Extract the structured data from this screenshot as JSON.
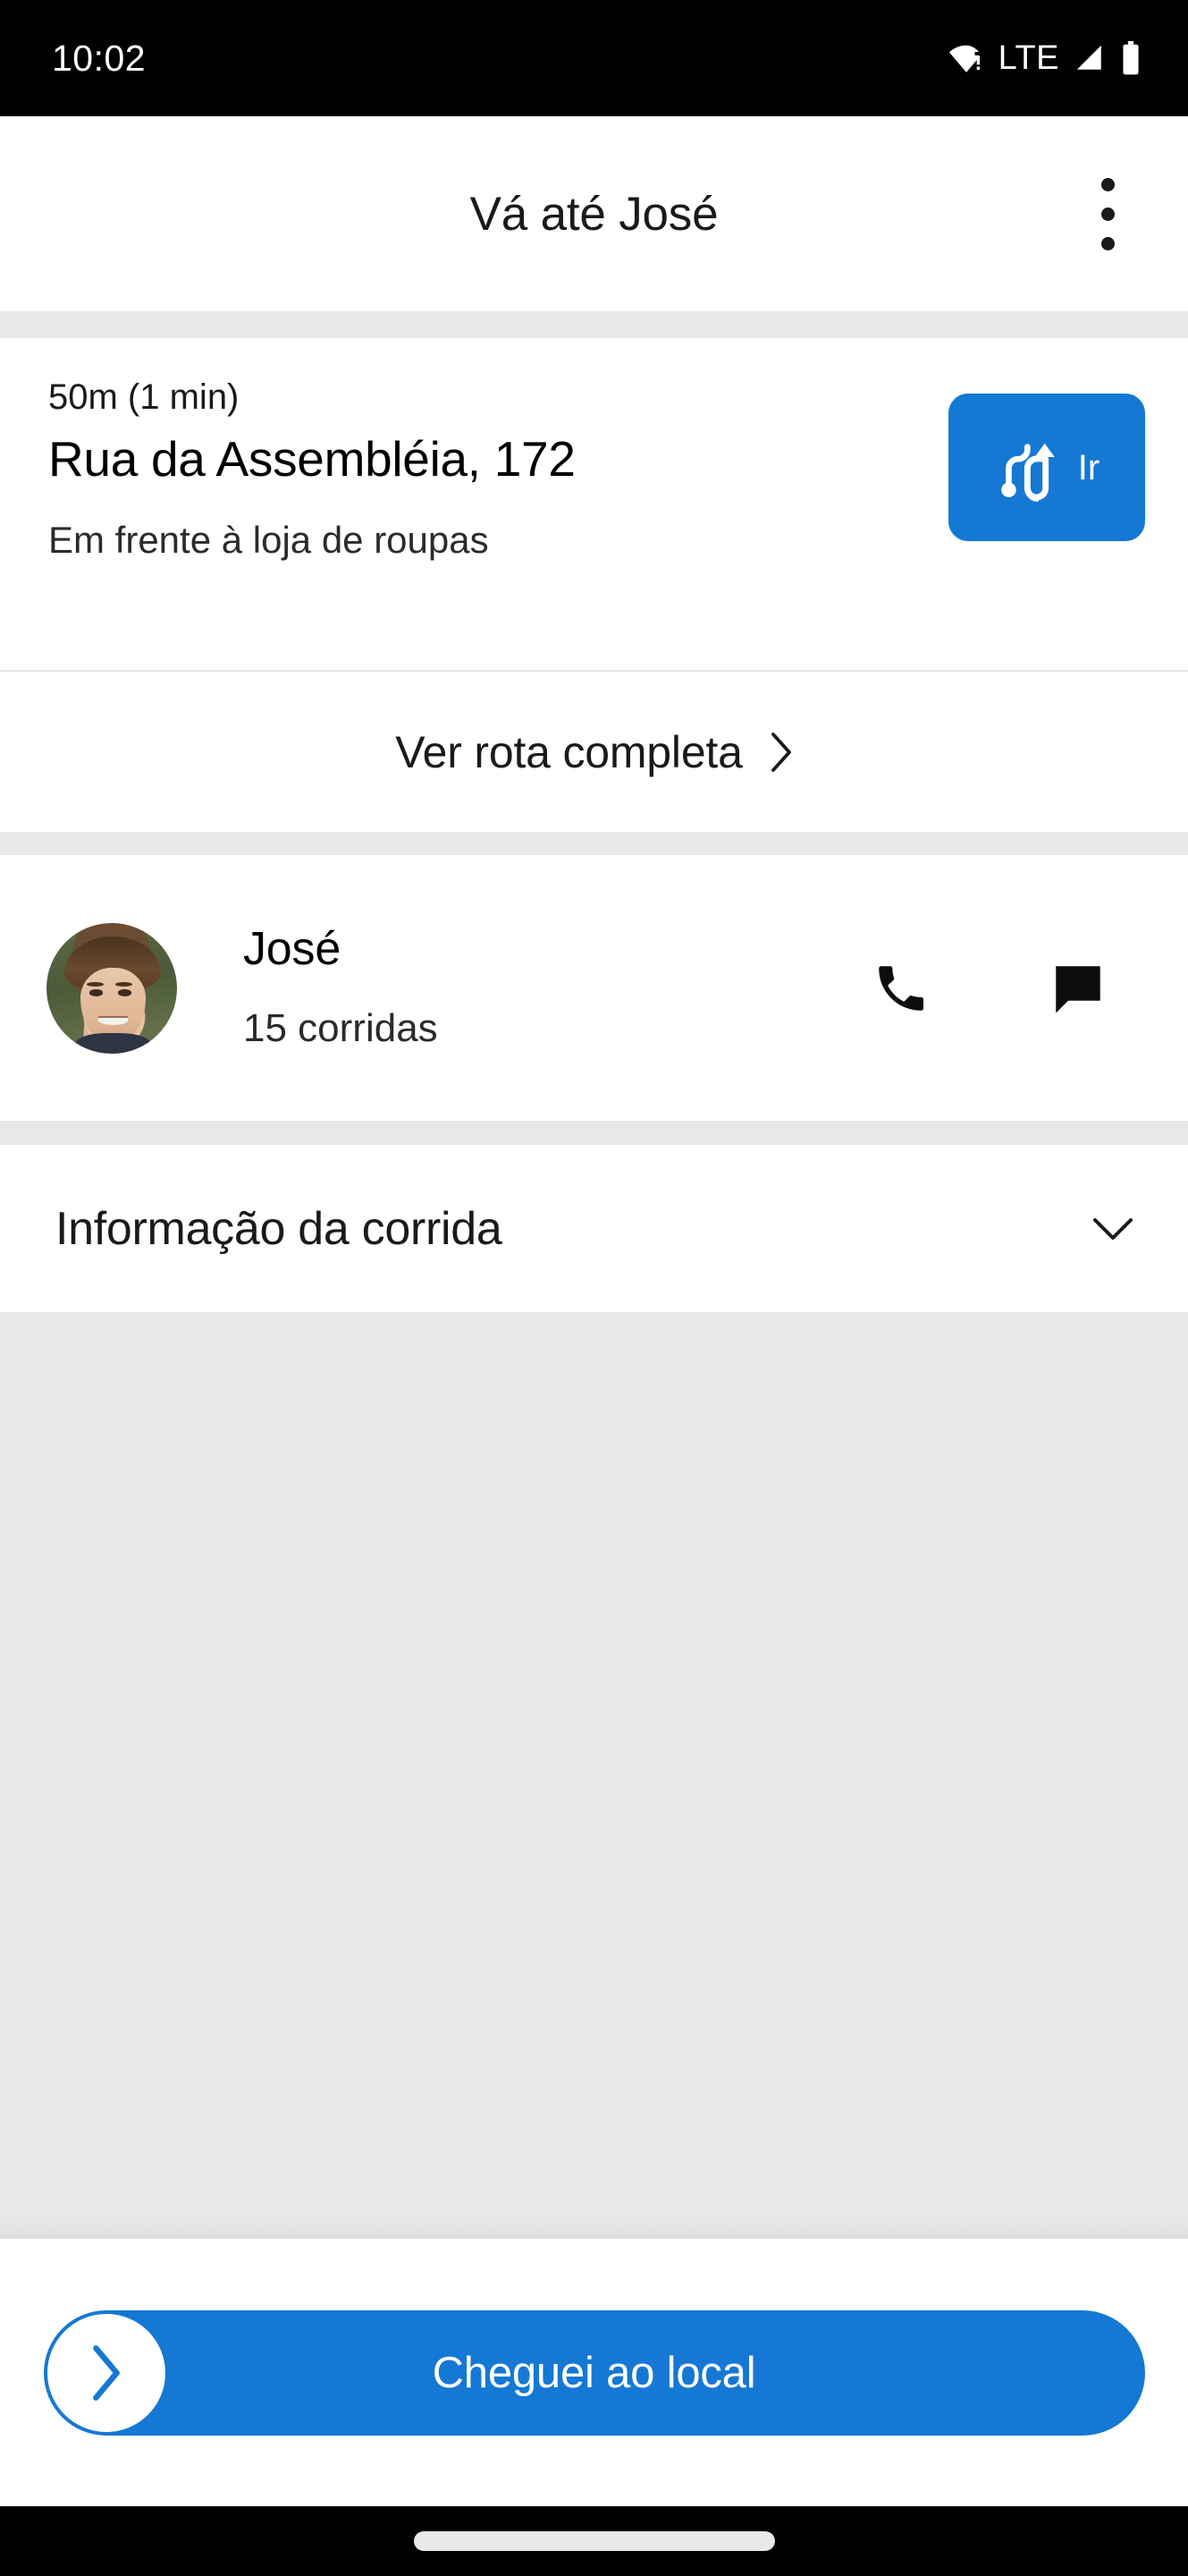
{
  "status_bar": {
    "time": "10:02",
    "network_label": "LTE",
    "icons": [
      "wifi-warning-icon",
      "lte-label",
      "cellular-signal-icon",
      "battery-icon"
    ]
  },
  "app_bar": {
    "title": "Vá até José",
    "overflow_icon": "more-vertical-icon"
  },
  "address_card": {
    "eta": "50m (1 min)",
    "street": "Rua da Assembléia, 172",
    "note": "Em frente à loja de roupas",
    "go_button": {
      "label": "Ir",
      "icon": "directions-route-icon",
      "color": "#1578d4"
    }
  },
  "route_link": {
    "label": "Ver rota completa",
    "icon": "chevron-right-icon"
  },
  "rider": {
    "name": "José",
    "trips": "15 corridas",
    "avatar_icon": "user-photo-avatar",
    "actions": [
      {
        "name": "call",
        "icon": "phone-icon"
      },
      {
        "name": "message",
        "icon": "chat-bubble-icon"
      }
    ]
  },
  "ride_info": {
    "label": "Informação da corrida",
    "icon": "chevron-down-icon",
    "expanded": false
  },
  "cta": {
    "label": "Cheguei ao local",
    "icon": "chevron-right-icon",
    "color": "#1578d4"
  },
  "system_nav": {
    "home_indicator": "home-indicator-pill"
  },
  "colors": {
    "accent": "#1578d4",
    "background": "#ffffff",
    "panel": "#e8e8e8",
    "divider": "#e3e3e3",
    "text_primary": "#000000",
    "status_bar": "#000000"
  }
}
